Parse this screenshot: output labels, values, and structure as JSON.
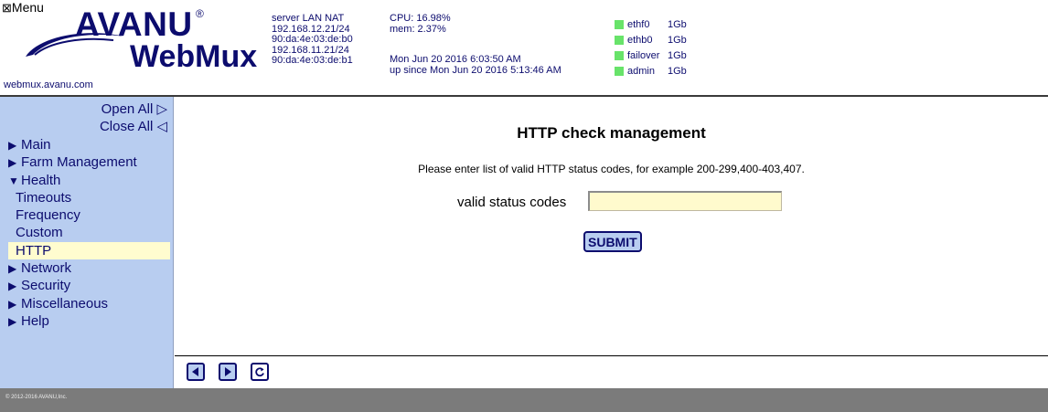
{
  "header": {
    "menu_label": "Menu",
    "logo_avanu": "AVANU",
    "logo_registered": "®",
    "logo_product": "WebMux",
    "domain": "webmux.avanu.com",
    "network": [
      "server LAN NAT",
      "192.168.12.21/24",
      "90:da:4e:03:de:b0",
      "192.168.11.21/24",
      "90:da:4e:03:de:b1"
    ],
    "cpu": "CPU: 16.98%",
    "mem": "mem: 2.37%",
    "date": "Mon Jun 20 2016 6:03:50 AM",
    "uptime": "up since Mon Jun 20 2016 5:13:46 AM",
    "interfaces": [
      {
        "name": "ethf0",
        "speed": "1Gb",
        "status_color": "#68e36a"
      },
      {
        "name": "ethb0",
        "speed": "1Gb",
        "status_color": "#68e36a"
      },
      {
        "name": "failover",
        "speed": "1Gb",
        "status_color": "#68e36a"
      },
      {
        "name": "admin",
        "speed": "1Gb",
        "status_color": "#68e36a"
      }
    ]
  },
  "sidebar": {
    "open_all": "Open All ▷",
    "close_all": "Close All ◁",
    "items": [
      {
        "label": "Main",
        "expanded": false
      },
      {
        "label": "Farm Management",
        "expanded": false
      },
      {
        "label": "Health",
        "expanded": true
      },
      {
        "label": "Network",
        "expanded": false
      },
      {
        "label": "Security",
        "expanded": false
      },
      {
        "label": "Miscellaneous",
        "expanded": false
      },
      {
        "label": "Help",
        "expanded": false
      }
    ],
    "health_subitems": [
      "Timeouts",
      "Frequency",
      "Custom",
      "HTTP"
    ],
    "active_subitem": "HTTP"
  },
  "main": {
    "title": "HTTP check management",
    "hint": "Please enter list of valid HTTP status codes, for example 200-299,400-403,407.",
    "field_label": "valid status codes",
    "field_value": "",
    "submit_label": "SUBMIT"
  },
  "toolbar": {
    "icons": [
      "back-arrow-icon",
      "forward-arrow-icon",
      "reload-icon"
    ]
  },
  "footer": {
    "copyright": "© 2012-2016 AVANU,Inc."
  },
  "colors": {
    "brand": "#0c0c6e",
    "sidebar_bg": "#b8cdf0",
    "active_bg": "#fffccf",
    "input_bg": "#fffacd",
    "status_ok": "#68e36a",
    "footer_bg": "#7b7b7b"
  }
}
